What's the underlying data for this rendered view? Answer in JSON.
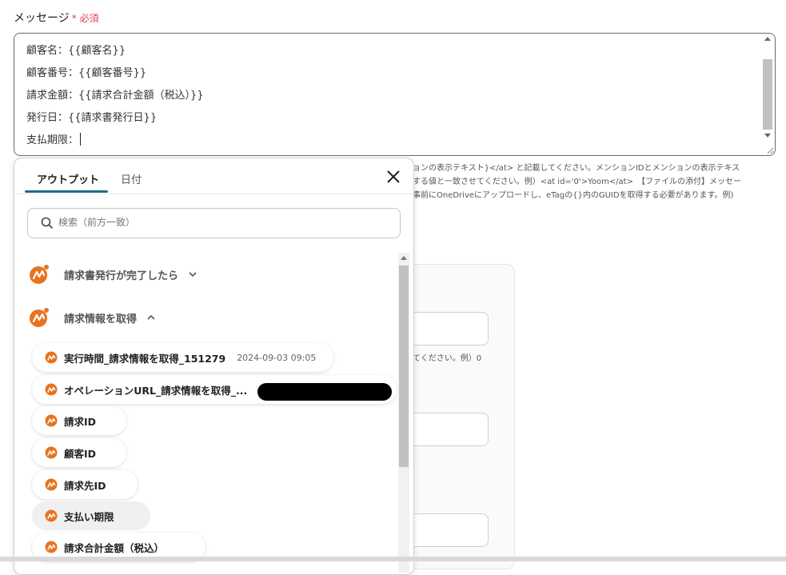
{
  "field": {
    "label": "メッセージ",
    "required_mark": "*",
    "required_text": "必須"
  },
  "message": {
    "lines": [
      "顧客名：{{顧客名}}",
      "顧客番号：{{顧客番号}}",
      "請求金額：{{請求合計金額（税込）}}",
      "発行日：{{請求書発行日}}",
      "支払期限："
    ]
  },
  "help_text": [
    "ョンの表示テキスト}</at> と記載してください。メンションIDとメンションの表示テキス",
    "する値と一致させてください。例）<at id='0'>Yoom</at>　【ファイルの添付】メッセー",
    "事前にOneDriveにアップロードし、eTagの{}内のGUIDを取得する必要があります。例)"
  ],
  "background_note": "てください。例）0",
  "panel": {
    "tabs": [
      {
        "label": "アウトプット",
        "active": true
      },
      {
        "label": "日付",
        "active": false
      }
    ],
    "search_placeholder": "検索（前方一致）",
    "groups": [
      {
        "label": "請求書発行が完了したら",
        "expanded": false
      },
      {
        "label": "請求情報を取得",
        "expanded": true
      }
    ],
    "items": [
      {
        "label": "実行時間_請求情報を取得_151279",
        "value": "2024-09-03 09:05"
      },
      {
        "label": "オペレーションURL_請求情報を取得_...",
        "value": ""
      },
      {
        "label": "請求ID",
        "value": ""
      },
      {
        "label": "顧客ID",
        "value": ""
      },
      {
        "label": "請求先ID",
        "value": ""
      },
      {
        "label": "支払い期限",
        "value": ""
      },
      {
        "label": "請求合計金額（税込）",
        "value": ""
      }
    ]
  },
  "colors": {
    "accent": "#1e6b8a",
    "required": "#e0454f",
    "logo": "#e8731f"
  }
}
